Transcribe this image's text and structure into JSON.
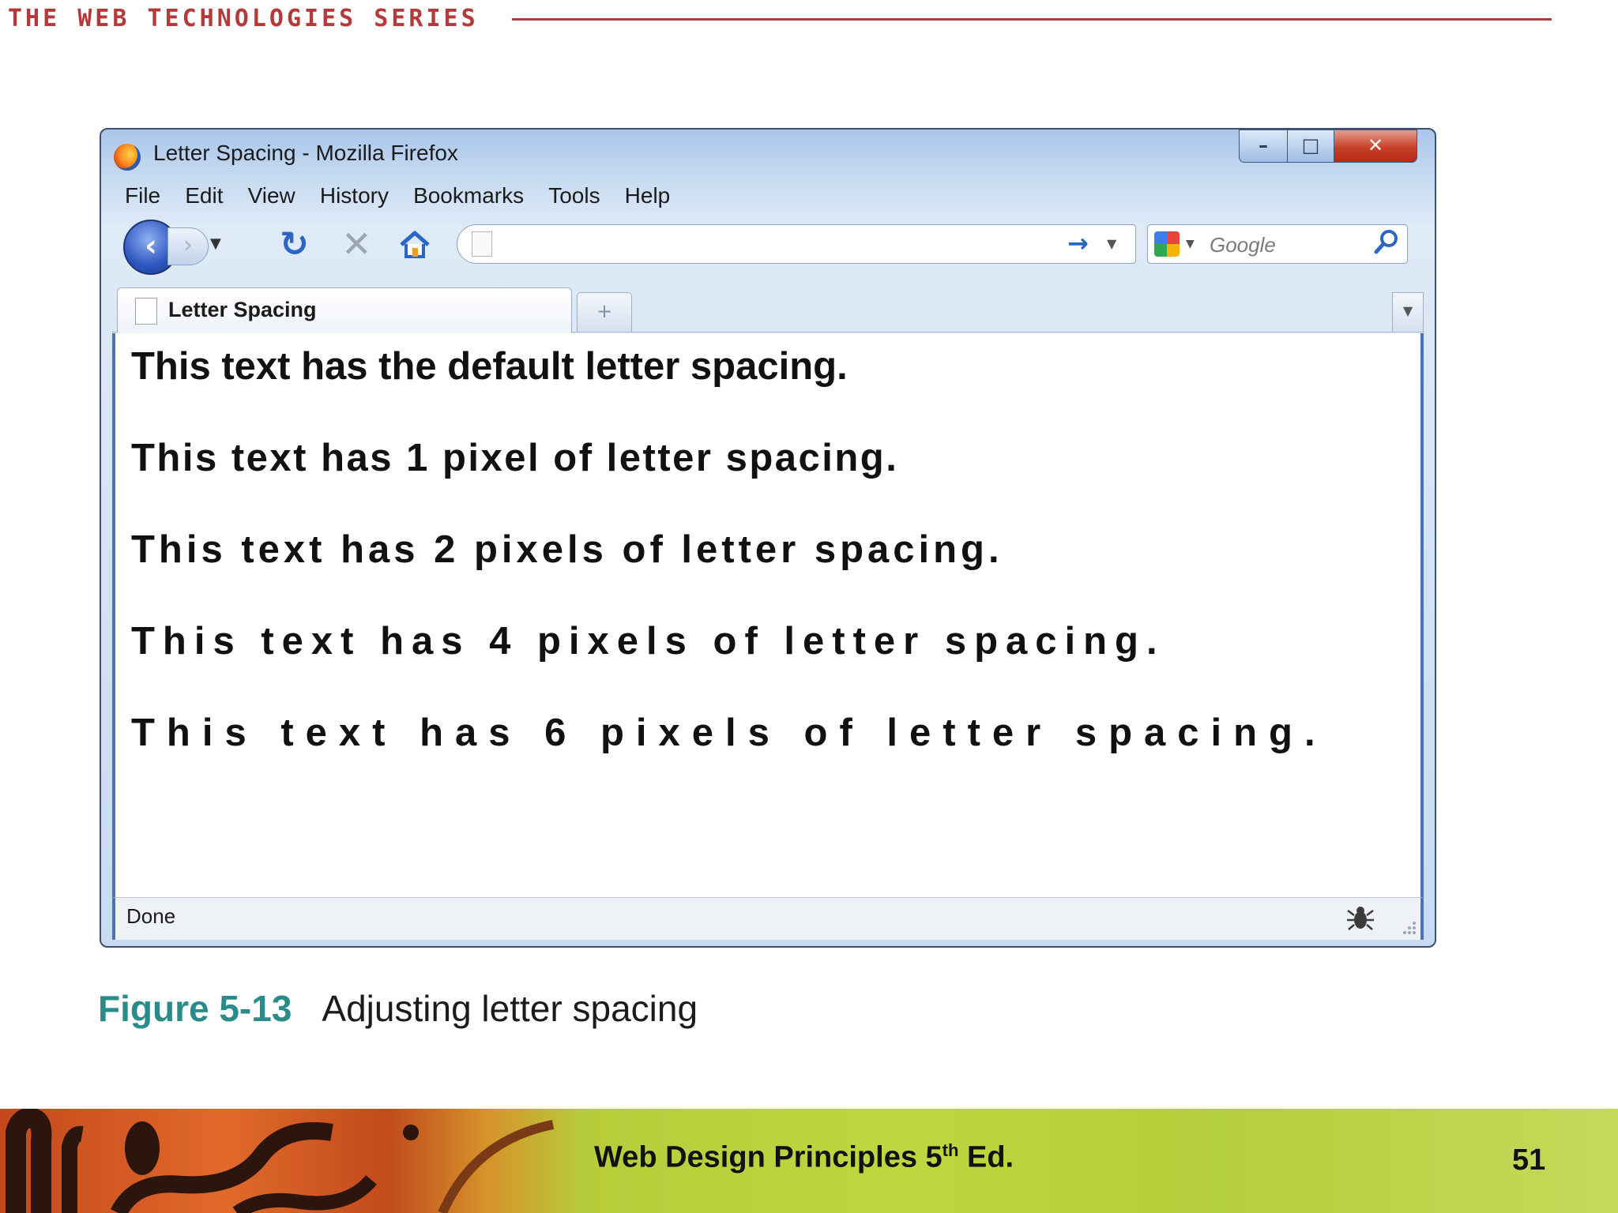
{
  "slide": {
    "series_title": "THE WEB TECHNOLOGIES SERIES",
    "caption_label": "Figure 5-13",
    "caption_text": "Adjusting letter spacing",
    "footer_title": "Web Design Principles 5",
    "footer_sup": "th",
    "footer_suffix": " Ed.",
    "page_number": "51"
  },
  "browser": {
    "window_title": "Letter Spacing - Mozilla Firefox",
    "menu": [
      "File",
      "Edit",
      "View",
      "History",
      "Bookmarks",
      "Tools",
      "Help"
    ],
    "url_value": "",
    "search_placeholder": "Google",
    "tab_label": "Letter Spacing",
    "status_text": "Done",
    "icons": {
      "app": "firefox-icon",
      "back": "back-arrow-icon",
      "forward": "forward-arrow-icon",
      "reload": "reload-icon",
      "stop": "stop-icon",
      "home": "home-icon",
      "go": "go-arrow-icon",
      "search_engine": "google-icon",
      "search": "magnifier-icon",
      "new_tab": "plus-icon",
      "status": "bug-icon"
    }
  },
  "page_content": {
    "lines": [
      "This text has the default letter spacing.",
      "This text has 1 pixel of letter spacing.",
      "This text has 2 pixels of letter spacing.",
      "This text has 4 pixels of letter spacing.",
      "This text has 6 pixels of letter spacing."
    ]
  },
  "colors": {
    "series_accent": "#b23a3a",
    "caption_accent": "#2a8c8a",
    "window_frame": "#4a74b0"
  }
}
